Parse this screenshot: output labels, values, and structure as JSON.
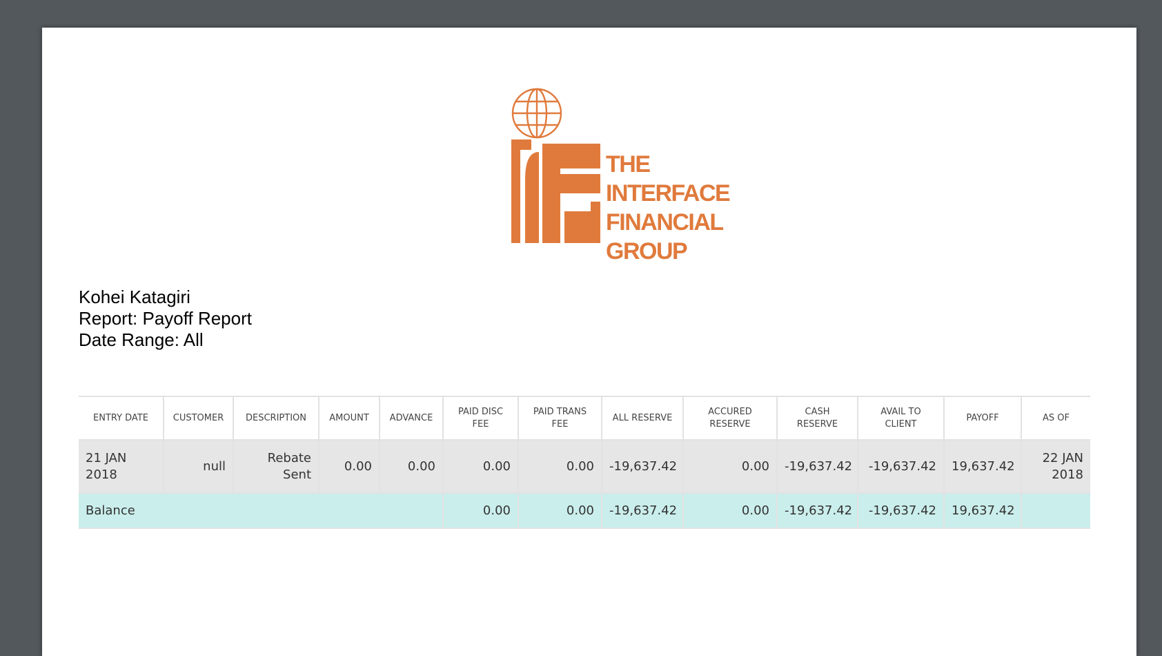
{
  "logo": {
    "icon": "ifg-globe-logo",
    "color": "#e07a3c",
    "lines": [
      "THE",
      "INTERFACE",
      "FINANCIAL",
      "GROUP"
    ]
  },
  "info": {
    "name": "Kohei Katagiri",
    "report": "Report: Payoff Report",
    "date_range": "Date Range: All"
  },
  "table": {
    "headers": [
      [
        "ENTRY DATE"
      ],
      [
        "CUSTOMER"
      ],
      [
        "DESCRIPTION"
      ],
      [
        "AMOUNT"
      ],
      [
        "ADVANCE"
      ],
      [
        "PAID DISC",
        "FEE"
      ],
      [
        "PAID TRANS",
        "FEE"
      ],
      [
        "ALL RESERVE"
      ],
      [
        "ACCURED",
        "RESERVE"
      ],
      [
        "CASH",
        "RESERVE"
      ],
      [
        "AVAIL TO",
        "CLIENT"
      ],
      [
        "PAYOFF"
      ],
      [
        "AS OF"
      ]
    ],
    "rows": [
      {
        "entry_date": [
          "21 JAN",
          "2018"
        ],
        "customer": "null",
        "description": [
          "Rebate",
          "Sent"
        ],
        "amount": "0.00",
        "advance": "0.00",
        "paid_disc_fee": "0.00",
        "paid_trans_fee": "0.00",
        "all_reserve": "-19,637.42",
        "accured_reserve": "0.00",
        "cash_reserve": "-19,637.42",
        "avail_to_client": "-19,637.42",
        "payoff": "19,637.42",
        "as_of": [
          "22 JAN",
          "2018"
        ]
      }
    ],
    "balance": {
      "label": "Balance",
      "paid_disc_fee": "0.00",
      "paid_trans_fee": "0.00",
      "all_reserve": "-19,637.42",
      "accured_reserve": "0.00",
      "cash_reserve": "-19,637.42",
      "avail_to_client": "-19,637.42",
      "payoff": "19,637.42",
      "as_of": ""
    }
  }
}
